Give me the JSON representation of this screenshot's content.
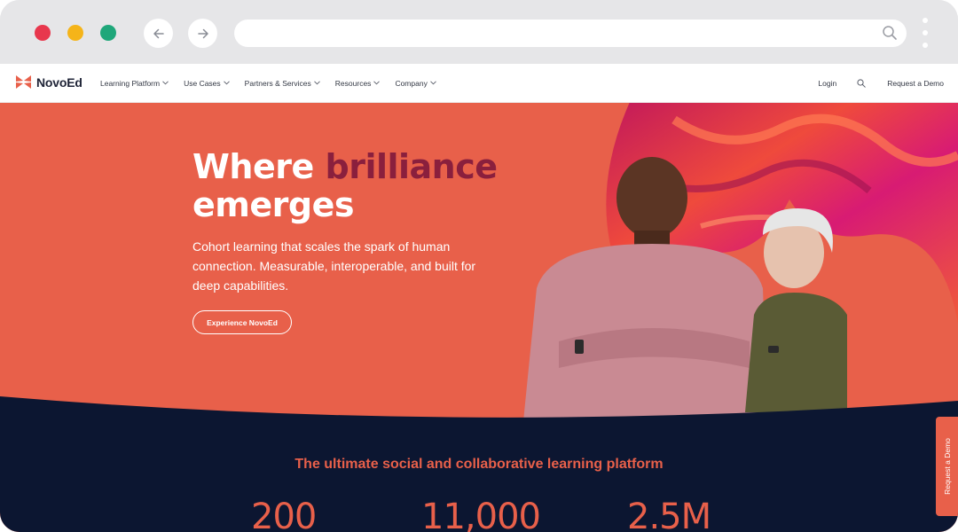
{
  "browser": {
    "traffic_colors": {
      "red": "#e8374d",
      "yellow": "#f5b419",
      "green": "#1fa77a"
    },
    "url": ""
  },
  "site": {
    "brand": "NovoEd",
    "nav": [
      {
        "label": "Learning Platform"
      },
      {
        "label": "Use Cases"
      },
      {
        "label": "Partners & Services"
      },
      {
        "label": "Resources"
      },
      {
        "label": "Company"
      }
    ],
    "login": "Login",
    "request_demo": "Request a Demo"
  },
  "hero": {
    "title_line1_plain": "Where",
    "title_line1_accent": "brilliance",
    "title_line2": "emerges",
    "subtitle": "Cohort learning that scales the spark of human connection. Measurable, interoperable, and built for deep capabilities.",
    "cta": "Experience NovoEd"
  },
  "band": {
    "title": "The ultimate social and collaborative learning platform",
    "stats": [
      "200",
      "11,000",
      "2.5M"
    ]
  },
  "side_tab": "Request a Demo",
  "colors": {
    "brand_coral": "#e8604a",
    "navy": "#0c1631",
    "accent_burgundy": "#8a1f3d"
  }
}
